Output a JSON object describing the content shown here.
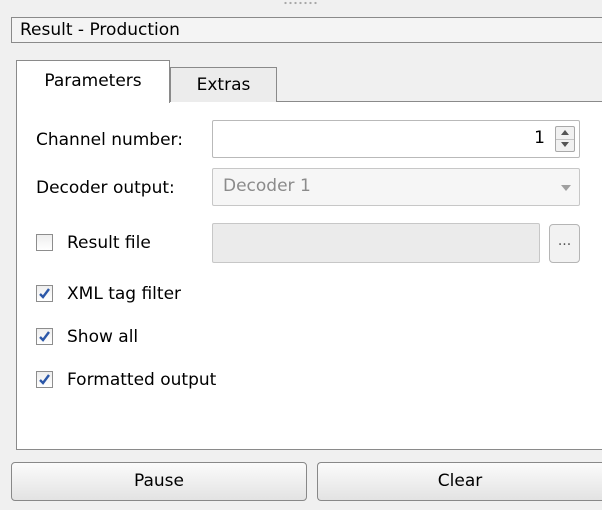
{
  "window": {
    "title": "Result - Production"
  },
  "tabs": [
    {
      "label": "Parameters",
      "active": true
    },
    {
      "label": "Extras",
      "active": false
    }
  ],
  "parameters": {
    "channel_number": {
      "label": "Channel number:",
      "value": "1"
    },
    "decoder_output": {
      "label": "Decoder output:",
      "value": "Decoder 1",
      "enabled": false
    },
    "result_file": {
      "label": "Result file",
      "checked": false,
      "path": "",
      "browse_label": "..."
    },
    "xml_tag_filter": {
      "label": "XML tag filter",
      "checked": true
    },
    "show_all": {
      "label": "Show all",
      "checked": true
    },
    "formatted_output": {
      "label": "Formatted output",
      "checked": true
    }
  },
  "buttons": {
    "pause": "Pause",
    "clear": "Clear"
  }
}
